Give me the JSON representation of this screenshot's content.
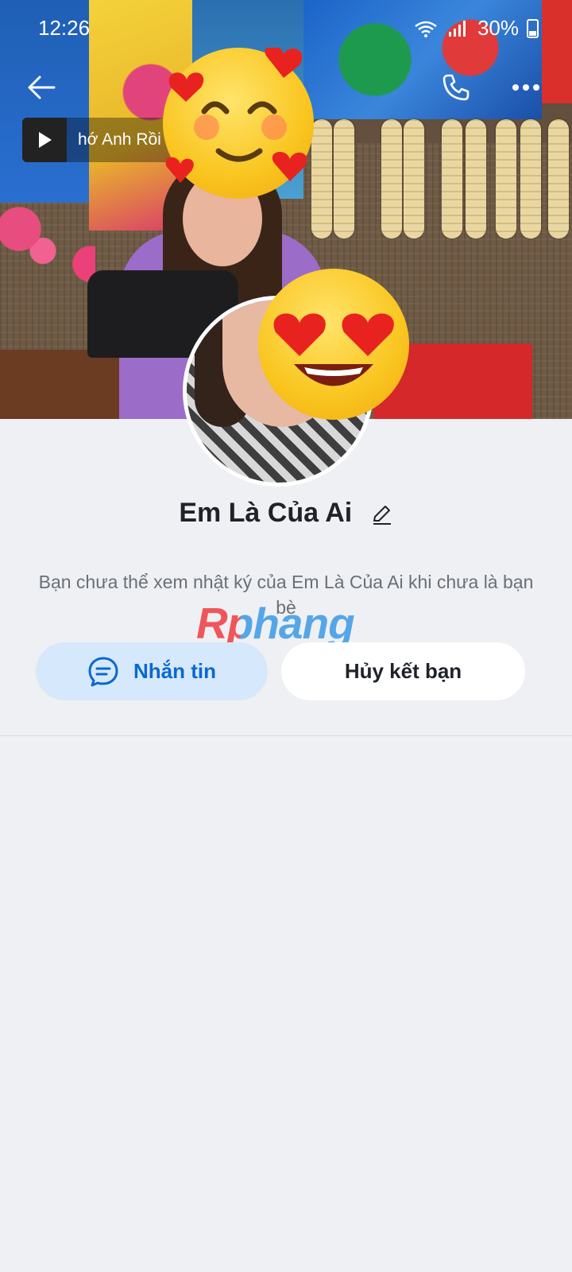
{
  "status_bar": {
    "time": "12:26",
    "battery_percent": "30%",
    "icons": [
      "wifi-icon",
      "signal-icon",
      "battery-icon"
    ]
  },
  "header": {
    "back_icon": "arrow-left-icon",
    "call_icon": "phone-icon",
    "more_icon": "more-horizontal-icon"
  },
  "music": {
    "title": "hớ Anh Rồi",
    "play_icon": "play-icon"
  },
  "stickers": [
    "smiling-face-with-hearts-icon",
    "heart-eyes-face-icon"
  ],
  "profile": {
    "name": "Em Là Của Ai",
    "edit_icon": "pencil-icon",
    "notice": "Bạn chưa thể xem nhật ký của Em Là Của Ai khi chưa là bạn bè"
  },
  "watermark": "Rphang",
  "actions": {
    "message_label": "Nhắn tin",
    "message_icon": "chat-bubble-icon",
    "unfriend_label": "Hủy kết bạn"
  },
  "colors": {
    "background": "#eef0f3",
    "accent": "#0b68d0",
    "message_button_bg": "#d6e8fb"
  }
}
